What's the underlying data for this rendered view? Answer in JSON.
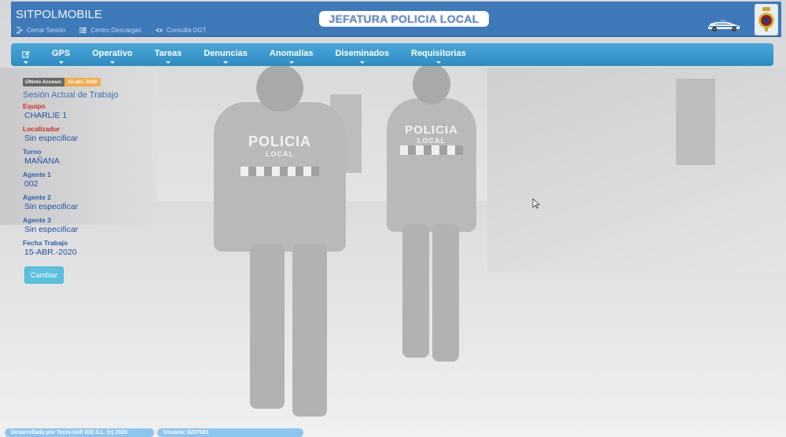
{
  "header": {
    "brand": "SITPOLMOBILE",
    "links": [
      {
        "label": "Cerrar Sesión",
        "icon": "logout-icon"
      },
      {
        "label": "Centro Descargas",
        "icon": "list-icon"
      },
      {
        "label": "Consulta DGT",
        "icon": "eye-icon"
      }
    ],
    "title": "JEFATURA POLICIA LOCAL",
    "accent": "#3e79ba"
  },
  "background": {
    "officer_label": "POLICIA",
    "officer_sublabel": "LOCAL"
  },
  "navbar": {
    "items": [
      {
        "label": "GPS"
      },
      {
        "label": "Operativo"
      },
      {
        "label": "Tareas"
      },
      {
        "label": "Denuncias"
      },
      {
        "label": "Anomalías"
      },
      {
        "label": "Diseminados"
      },
      {
        "label": "Requisitorias"
      }
    ]
  },
  "session": {
    "last_access_label": "Último Acceso:",
    "last_access_value": "15-abr.-2020",
    "title": "Sesión Actual de Trabajo",
    "fields": [
      {
        "label": "Equipo",
        "value": "CHARLIE 1"
      },
      {
        "label": "Localizador",
        "value": "Sin especificar"
      },
      {
        "label": "Turno",
        "value": "MAÑANA"
      },
      {
        "label": "Agente 1",
        "value": "002"
      },
      {
        "label": "Agente 2",
        "value": "Sin especificar"
      },
      {
        "label": "Agente 3",
        "value": "Sin especificar"
      },
      {
        "label": "Fecha Trabajo",
        "value": "15-ABR.-2020"
      }
    ],
    "change_button": "Cambiar"
  },
  "footer": {
    "developer": "Desarrollado por Tecni-Soft IDE S.L. (c) 2020",
    "user": "Usuario: 6207681"
  }
}
